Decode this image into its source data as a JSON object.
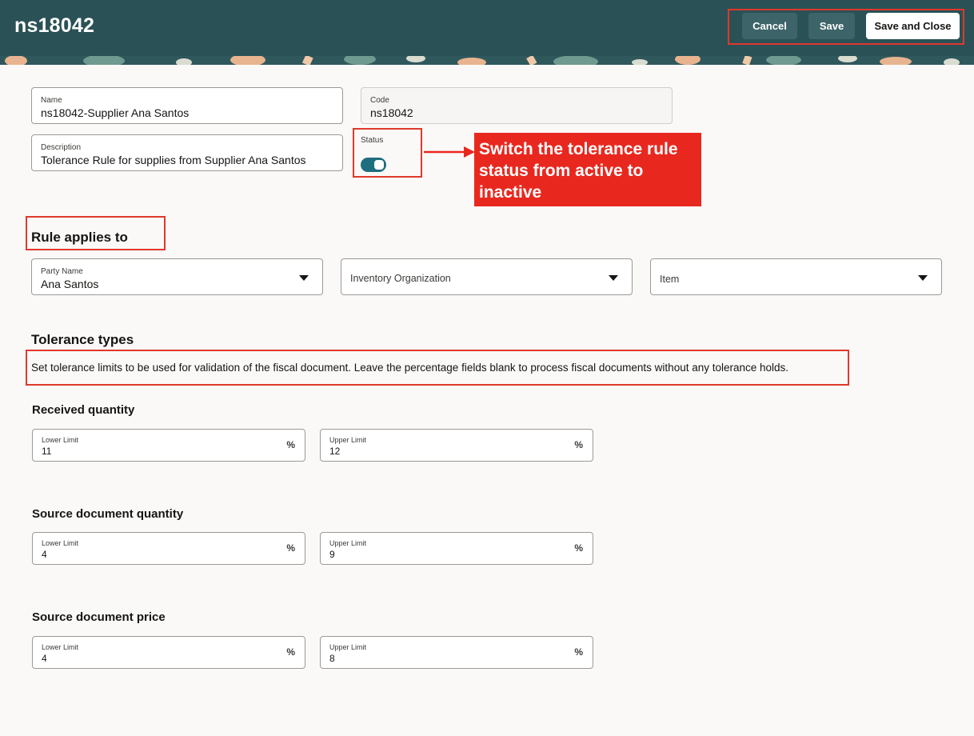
{
  "header": {
    "title": "ns18042",
    "cancel_label": "Cancel",
    "save_label": "Save",
    "save_close_label": "Save and Close"
  },
  "form": {
    "name": {
      "label": "Name",
      "value": "ns18042-Supplier Ana Santos"
    },
    "code": {
      "label": "Code",
      "value": "ns18042"
    },
    "description": {
      "label": "Description",
      "value": "Tolerance Rule for supplies from Supplier Ana Santos"
    },
    "status": {
      "label": "Status",
      "active": true
    }
  },
  "annotation": {
    "callout_text": "Switch the tolerance rule status from active to inactive"
  },
  "rule_applies": {
    "title": "Rule applies to",
    "party": {
      "label": "Party Name",
      "value": "Ana Santos"
    },
    "inventory_org": {
      "label": "Inventory Organization"
    },
    "item": {
      "label": "Item"
    }
  },
  "tolerance": {
    "title": "Tolerance types",
    "description": "Set tolerance limits to be used for validation of the fiscal document. Leave the percentage fields blank to process fiscal documents without any tolerance holds.",
    "percent_symbol": "%",
    "lower_label": "Lower Limit",
    "upper_label": "Upper Limit",
    "groups": [
      {
        "title": "Received quantity",
        "lower": "11",
        "upper": "12"
      },
      {
        "title": "Source document quantity",
        "lower": "4",
        "upper": "9"
      },
      {
        "title": "Source document price",
        "lower": "4",
        "upper": "8"
      }
    ]
  },
  "colors": {
    "header_bg": "#2a5156",
    "toggle_on": "#1f6e7f",
    "annotation_red": "#e8281f"
  }
}
